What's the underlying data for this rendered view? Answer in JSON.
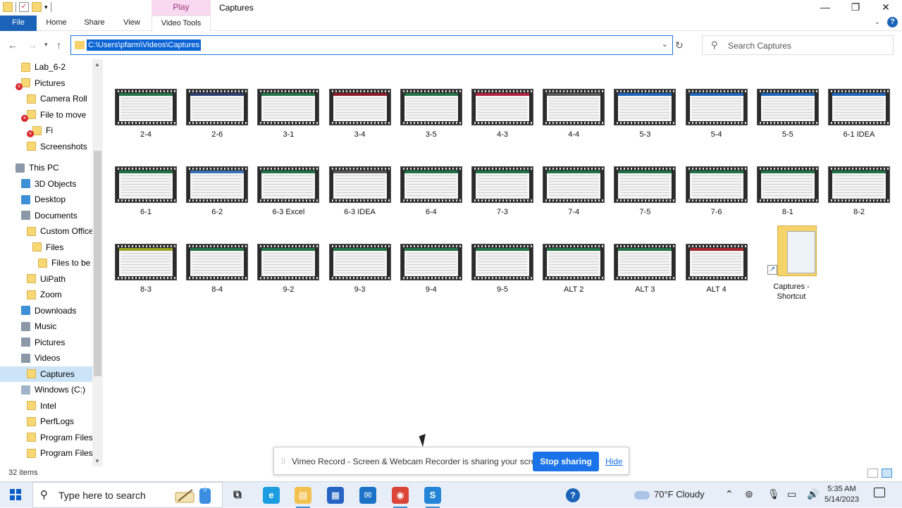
{
  "window": {
    "title": "Captures",
    "contextual_tab_group": "Play",
    "controls": {
      "minimize": "—",
      "maximize": "❐",
      "close": "✕"
    }
  },
  "ribbon": {
    "tabs": [
      "File",
      "Home",
      "Share",
      "View",
      "Video Tools"
    ],
    "help": "?"
  },
  "address": {
    "path": "C:\\Users\\pfarm\\Videos\\Captures",
    "search_placeholder": "Search Captures"
  },
  "nav_pane": [
    {
      "label": "Lab_6-2",
      "icon": "folder",
      "level": 2,
      "error": false
    },
    {
      "label": "Pictures",
      "icon": "folder",
      "level": 2,
      "error": true
    },
    {
      "label": "Camera Roll",
      "icon": "folder",
      "level": 3,
      "error": false
    },
    {
      "label": "File to move",
      "icon": "folder",
      "level": 3,
      "error": true
    },
    {
      "label": "Fi",
      "icon": "folder",
      "level": 4,
      "error": true
    },
    {
      "label": "Screenshots",
      "icon": "folder",
      "level": 3,
      "error": false
    },
    {
      "label": "This PC",
      "icon": "pc",
      "level": 1,
      "error": false
    },
    {
      "label": "3D Objects",
      "icon": "objects",
      "level": 2,
      "error": false
    },
    {
      "label": "Desktop",
      "icon": "desktop",
      "level": 2,
      "error": false
    },
    {
      "label": "Documents",
      "icon": "documents",
      "level": 2,
      "error": false
    },
    {
      "label": "Custom Office",
      "icon": "folder",
      "level": 3,
      "error": false
    },
    {
      "label": "Files",
      "icon": "folder",
      "level": 4,
      "error": false
    },
    {
      "label": "Files to be n",
      "icon": "folder",
      "level": 5,
      "error": false
    },
    {
      "label": "UiPath",
      "icon": "folder",
      "level": 3,
      "error": false
    },
    {
      "label": "Zoom",
      "icon": "folder",
      "level": 3,
      "error": false
    },
    {
      "label": "Downloads",
      "icon": "downloads",
      "level": 2,
      "error": false
    },
    {
      "label": "Music",
      "icon": "music",
      "level": 2,
      "error": false
    },
    {
      "label": "Pictures",
      "icon": "pictures",
      "level": 2,
      "error": false
    },
    {
      "label": "Videos",
      "icon": "videos",
      "level": 2,
      "error": false
    },
    {
      "label": "Captures",
      "icon": "folder",
      "level": 3,
      "error": false,
      "selected": true
    },
    {
      "label": "Windows (C:)",
      "icon": "drive",
      "level": 2,
      "error": false
    },
    {
      "label": "Intel",
      "icon": "folder",
      "level": 3,
      "error": false
    },
    {
      "label": "PerfLogs",
      "icon": "folder",
      "level": 3,
      "error": false
    },
    {
      "label": "Program Files",
      "icon": "folder",
      "level": 3,
      "error": false
    },
    {
      "label": "Program Files (",
      "icon": "folder",
      "level": 3,
      "error": false
    }
  ],
  "files": [
    {
      "name": "2-4",
      "tint": "#217346"
    },
    {
      "name": "2-6",
      "tint": "#2c3e70"
    },
    {
      "name": "3-1",
      "tint": "#217346"
    },
    {
      "name": "3-4",
      "tint": "#8b1a2a"
    },
    {
      "name": "3-5",
      "tint": "#217346"
    },
    {
      "name": "4-3",
      "tint": "#b01e3a"
    },
    {
      "name": "4-4",
      "tint": "#555555"
    },
    {
      "name": "5-3",
      "tint": "#1a63b8"
    },
    {
      "name": "5-4",
      "tint": "#1a63b8"
    },
    {
      "name": "5-5",
      "tint": "#1a63b8"
    },
    {
      "name": "6-1 IDEA",
      "tint": "#1a63b8"
    },
    {
      "name": "6-1",
      "tint": "#217346"
    },
    {
      "name": "6-2",
      "tint": "#3d6fb8"
    },
    {
      "name": "6-3 Excel",
      "tint": "#217346"
    },
    {
      "name": "6-3 IDEA",
      "tint": "#555555"
    },
    {
      "name": "6-4",
      "tint": "#217346"
    },
    {
      "name": "7-3",
      "tint": "#217346"
    },
    {
      "name": "7-4",
      "tint": "#217346"
    },
    {
      "name": "7-5",
      "tint": "#217346"
    },
    {
      "name": "7-6",
      "tint": "#217346"
    },
    {
      "name": "8-1",
      "tint": "#217346"
    },
    {
      "name": "8-2",
      "tint": "#217346"
    },
    {
      "name": "8-3",
      "tint": "#9aa321"
    },
    {
      "name": "8-4",
      "tint": "#217346"
    },
    {
      "name": "9-2",
      "tint": "#217346"
    },
    {
      "name": "9-3",
      "tint": "#217346"
    },
    {
      "name": "9-4",
      "tint": "#217346"
    },
    {
      "name": "9-5",
      "tint": "#217346"
    },
    {
      "name": "ALT 2",
      "tint": "#217346"
    },
    {
      "name": "ALT 3",
      "tint": "#217346"
    },
    {
      "name": "ALT 4",
      "tint": "#a4262c"
    }
  ],
  "shortcut": {
    "name_line1": "Captures -",
    "name_line2": "Shortcut"
  },
  "status": {
    "item_count": "32 items"
  },
  "sharing": {
    "message": "Vimeo Record - Screen & Webcam Recorder is sharing your screen.",
    "stop": "Stop sharing",
    "hide": "Hide"
  },
  "taskbar": {
    "search_placeholder": "Type here to search",
    "apps": [
      {
        "name": "task-view",
        "glyph": "⧉",
        "color": "#e7eef7"
      },
      {
        "name": "edge",
        "glyph": "e",
        "color": "#1b9de2"
      },
      {
        "name": "file-explorer",
        "glyph": "▤",
        "color": "#f2c14e"
      },
      {
        "name": "store",
        "glyph": "▦",
        "color": "#2564c4"
      },
      {
        "name": "mail",
        "glyph": "✉",
        "color": "#1a73c8"
      },
      {
        "name": "chrome",
        "glyph": "◉",
        "color": "#db4437"
      },
      {
        "name": "app-s",
        "glyph": "S",
        "color": "#2385d8"
      }
    ],
    "weather": "70°F  Cloudy",
    "time": "5:35 AM",
    "date": "5/14/2023"
  }
}
